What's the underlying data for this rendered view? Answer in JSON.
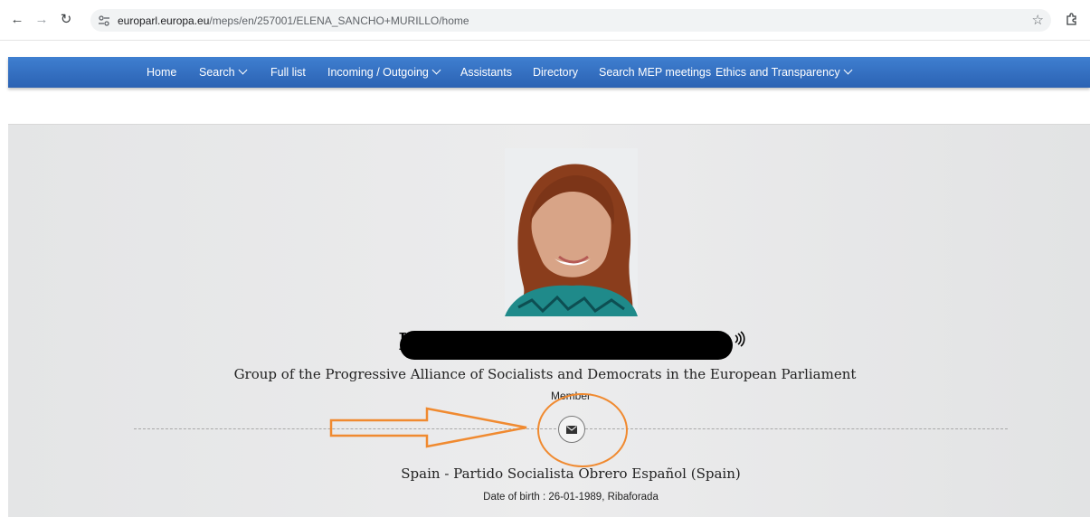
{
  "browser": {
    "url_host": "europarl.europa.eu",
    "url_path": "/meps/en/257001/ELENA_SANCHO+MURILLO/home",
    "icons": {
      "back": "back-arrow-icon",
      "forward": "forward-arrow-icon",
      "reload": "reload-icon",
      "site_info": "tune-icon",
      "bookmark": "star-icon",
      "extensions": "puzzle-icon"
    }
  },
  "nav": {
    "items": [
      {
        "label": "Home",
        "has_dropdown": false
      },
      {
        "label": "Search",
        "has_dropdown": true
      },
      {
        "label": "Full list",
        "has_dropdown": false
      },
      {
        "label": "Incoming / Outgoing",
        "has_dropdown": true
      },
      {
        "label": "Assistants",
        "has_dropdown": false
      },
      {
        "label": "Directory",
        "has_dropdown": false
      },
      {
        "label": "Search MEP meetings",
        "has_dropdown": false
      },
      {
        "label": "Ethics and Transparency",
        "has_dropdown": true
      }
    ],
    "background": "#2f6cc0"
  },
  "profile": {
    "name_visible_initial": "I",
    "group": "Group of the Progressive Alliance of Socialists and Democrats in the European Parliament",
    "role": "Member",
    "country_party": "Spain - Partido Socialista Obrero Español (Spain)",
    "birth": "Date of birth : 26-01-1989, Ribaforada"
  },
  "annotation": {
    "color": "#f08a30"
  }
}
